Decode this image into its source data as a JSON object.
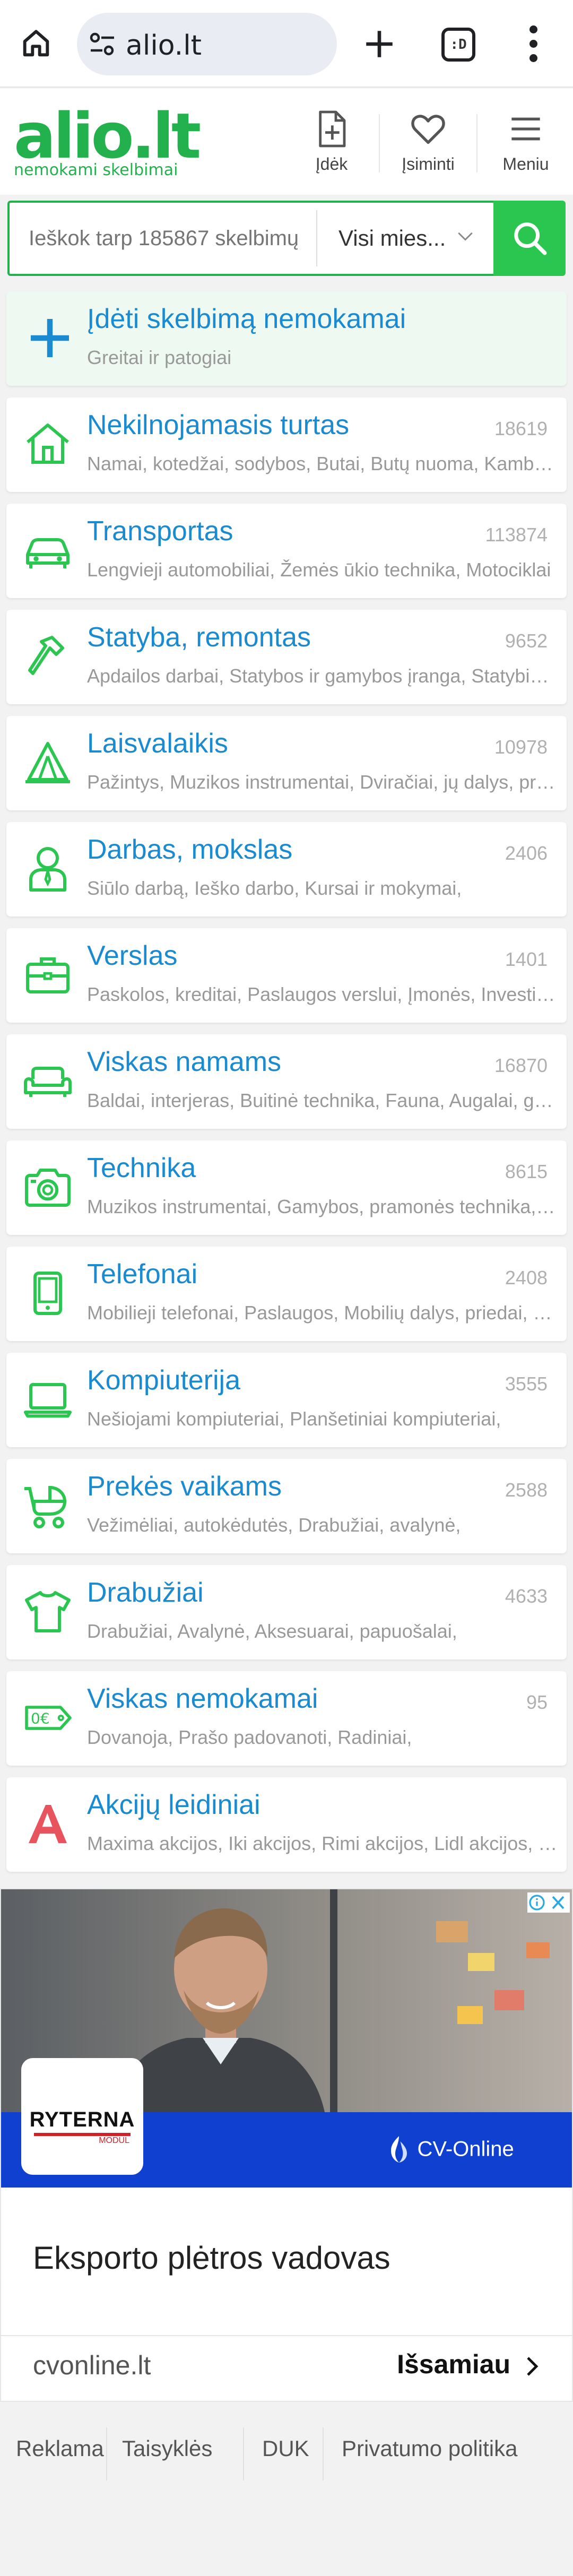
{
  "browser": {
    "url": "alio.lt",
    "tab_count": ":D"
  },
  "site": {
    "logo": "alio.lt",
    "tagline": "nemokami skelbimai",
    "header_buttons": [
      {
        "label": "Įdėk",
        "icon": "add-document-icon"
      },
      {
        "label": "Įsiminti",
        "icon": "heart-icon"
      },
      {
        "label": "Meniu",
        "icon": "hamburger-icon"
      }
    ]
  },
  "search": {
    "placeholder": "Ieškok tarp 185867 skelbimų",
    "location": "Visi mies..."
  },
  "add_listing": {
    "title": "Įdėti skelbimą nemokamai",
    "subtitle": "Greitai ir patogiai"
  },
  "categories": [
    {
      "title": "Nekilnojamasis turtas",
      "count": "18619",
      "subtitle": "Namai, kotedžai, sodybos, Butai, Butų nuoma, Kambariai",
      "icon": "house-icon"
    },
    {
      "title": "Transportas",
      "count": "113874",
      "subtitle": "Lengvieji automobiliai, Žemės ūkio technika, Motociklai",
      "icon": "car-icon"
    },
    {
      "title": "Statyba, remontas",
      "count": "9652",
      "subtitle": "Apdailos darbai, Statybos ir gamybos įranga, Statybinės medžiagos",
      "icon": "hammer-icon"
    },
    {
      "title": "Laisvalaikis",
      "count": "10978",
      "subtitle": "Pažintys, Muzikos instrumentai, Dviračiai, jų dalys, priedai",
      "icon": "tent-icon"
    },
    {
      "title": "Darbas, mokslas",
      "count": "2406",
      "subtitle": "Siūlo darbą, Ieško darbo, Kursai ir mokymai,",
      "icon": "person-icon"
    },
    {
      "title": "Verslas",
      "count": "1401",
      "subtitle": "Paskolos, kreditai, Paslaugos verslui, Įmonės, Investicijos",
      "icon": "briefcase-icon"
    },
    {
      "title": "Viskas namams",
      "count": "16870",
      "subtitle": "Baldai, interjeras, Buitinė technika, Fauna, Augalai, gėlės",
      "icon": "sofa-icon"
    },
    {
      "title": "Technika",
      "count": "8615",
      "subtitle": "Muzikos instrumentai, Gamybos, pramonės technika, įranga",
      "icon": "camera-icon"
    },
    {
      "title": "Telefonai",
      "count": "2408",
      "subtitle": "Mobilieji telefonai, Paslaugos, Mobilių dalys, priedai, aksesuarai",
      "icon": "phone-icon"
    },
    {
      "title": "Kompiuterija",
      "count": "3555",
      "subtitle": "Nešiojami kompiuteriai, Planšetiniai kompiuteriai,",
      "icon": "laptop-icon"
    },
    {
      "title": "Prekės vaikams",
      "count": "2588",
      "subtitle": "Vežimėliai, autokėdutės, Drabužiai, avalynė,",
      "icon": "stroller-icon"
    },
    {
      "title": "Drabužiai",
      "count": "4633",
      "subtitle": "Drabužiai, Avalynė, Aksesuarai, papuošalai,",
      "icon": "tshirt-icon"
    },
    {
      "title": "Viskas nemokamai",
      "count": "95",
      "subtitle": "Dovanoja, Prašo padovanoti, Radiniai,",
      "icon": "price-tag-icon"
    },
    {
      "title": "Akcijų leidiniai",
      "count": "",
      "subtitle": "Maxima akcijos, Iki akcijos, Rimi akcijos, Lidl akcijos, Norfa akcijos",
      "icon": "letter-a-icon"
    }
  ],
  "ad": {
    "brand_left": "RYTERNA",
    "brand_left_sub": "MODUL",
    "brand_right": "CV-Online",
    "headline": "Eksporto plėtros vadovas",
    "domain": "cvonline.lt",
    "cta": "Išsamiau"
  },
  "footer": {
    "links": [
      "Reklama",
      "Taisyklės",
      "DUK",
      "Privatumo politika"
    ]
  },
  "colors": {
    "brand_green": "#23b14d",
    "title_blue": "#1a8ad1",
    "icon_green": "#2ac64f",
    "ad_blue": "#1040d0"
  }
}
